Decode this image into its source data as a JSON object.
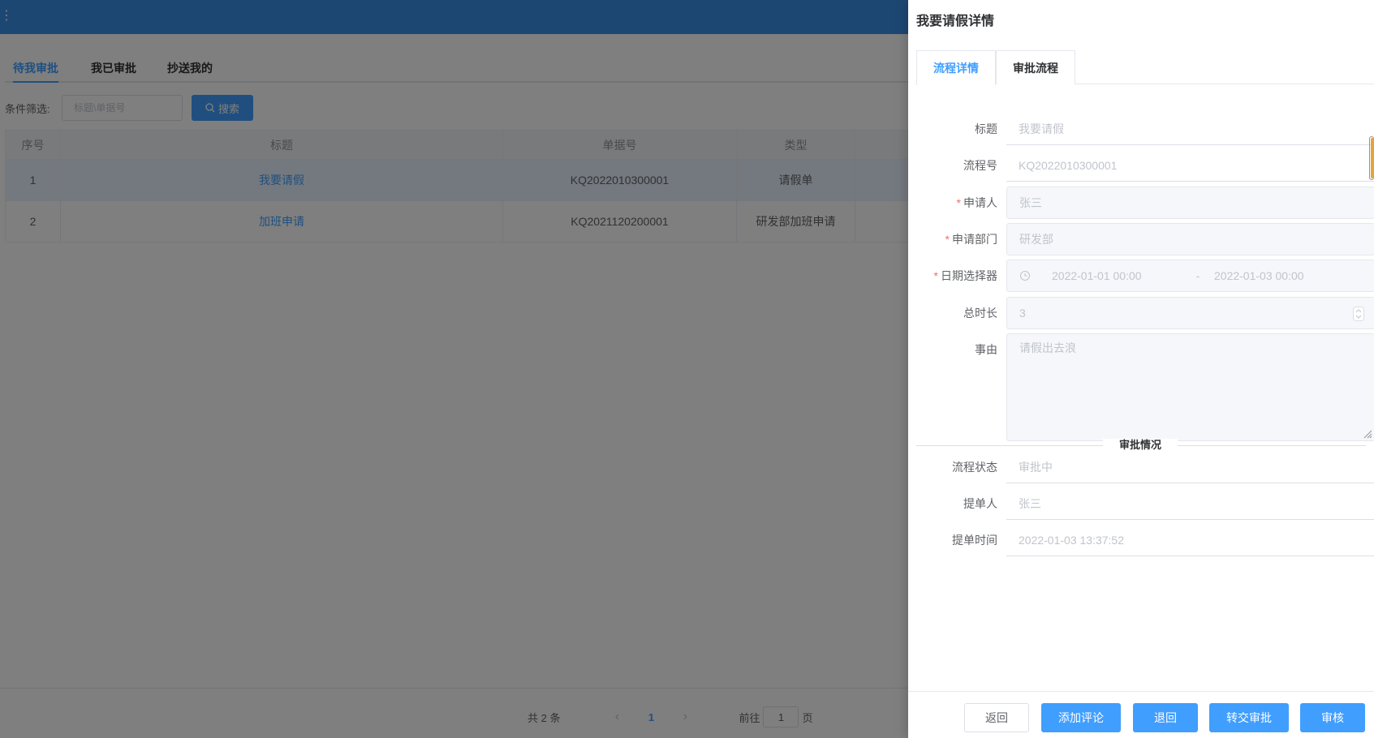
{
  "app": {
    "tabs": [
      {
        "label": "待我审批"
      },
      {
        "label": "我已审批"
      },
      {
        "label": "抄送我的"
      }
    ],
    "filter": {
      "label": "条件筛选:",
      "placeholder": "标题\\单据号",
      "search_label": "搜索"
    },
    "table": {
      "headers": [
        "序号",
        "标题",
        "单据号",
        "类型"
      ],
      "rows": [
        {
          "index": "1",
          "title": "我要请假",
          "doc_no": "KQ2022010300001",
          "type": "请假单"
        },
        {
          "index": "2",
          "title": "加班申请",
          "doc_no": "KQ2021120200001",
          "type": "研发部加班申请"
        }
      ]
    },
    "pager": {
      "total": "共 2 条",
      "prev": "‹",
      "current": "1",
      "next": "›",
      "goto_prefix": "前往",
      "goto_value": "1",
      "goto_suffix": "页"
    }
  },
  "drawer": {
    "title": "我要请假详情",
    "tabs": [
      {
        "label": "流程详情"
      },
      {
        "label": "审批流程"
      }
    ],
    "fields": {
      "title": {
        "label": "标题",
        "value": "我要请假"
      },
      "flow_no": {
        "label": "流程号",
        "value": "KQ2022010300001"
      },
      "applicant": {
        "label": "申请人",
        "value": "张三"
      },
      "department": {
        "label": "申请部门",
        "value": "研发部"
      },
      "date_picker": {
        "label": "日期选择器",
        "start": "2022-01-01 00:00",
        "separator": "-",
        "end": "2022-01-03 00:00"
      },
      "duration": {
        "label": "总时长",
        "value": "3"
      },
      "reason": {
        "label": "事由",
        "value": "请假出去浪"
      }
    },
    "divider_label": "审批情况",
    "status": {
      "flow_status": {
        "label": "流程状态",
        "value": "审批中"
      },
      "submitter": {
        "label": "提单人",
        "value": "张三"
      },
      "submit_time": {
        "label": "提单时间",
        "value": "2022-01-03 13:37:52"
      }
    },
    "footer": {
      "back": "返回",
      "add_comment": "添加评论",
      "reject": "退回",
      "transfer": "转交审批",
      "approve": "审核"
    }
  },
  "colors": {
    "primary": "#409eff",
    "header": "#3a8ee6",
    "required": "#f56c6c"
  }
}
